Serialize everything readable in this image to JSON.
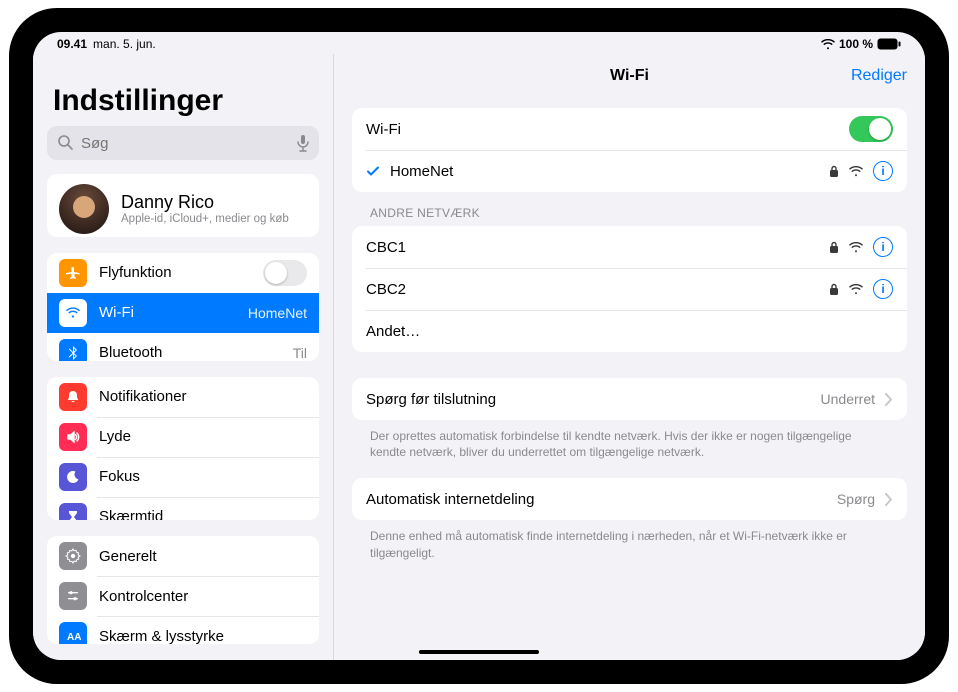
{
  "status": {
    "time": "09.41",
    "date": "man. 5. jun.",
    "battery": "100 %"
  },
  "sidebar": {
    "title": "Indstillinger",
    "search_placeholder": "Søg",
    "account": {
      "name": "Danny Rico",
      "subtitle": "Apple-id, iCloud+, medier og køb"
    },
    "group1": {
      "airplane": "Flyfunktion",
      "wifi": "Wi-Fi",
      "wifi_value": "HomeNet",
      "bt": "Bluetooth",
      "bt_value": "Til"
    },
    "group2": {
      "notifications": "Notifikationer",
      "sounds": "Lyde",
      "focus": "Fokus",
      "screentime": "Skærmtid"
    },
    "group3": {
      "general": "Generelt",
      "control": "Kontrolcenter",
      "display": "Skærm & lysstyrke"
    }
  },
  "detail": {
    "title": "Wi-Fi",
    "edit": "Rediger",
    "wifi_label": "Wi-Fi",
    "connected": "HomeNet",
    "other_header": "ANDRE NETVÆRK",
    "networks": [
      {
        "name": "CBC1"
      },
      {
        "name": "CBC2"
      }
    ],
    "other_item": "Andet…",
    "ask": {
      "label": "Spørg før tilslutning",
      "value": "Underret",
      "note": "Der oprettes automatisk forbindelse til kendte netværk. Hvis der ikke er nogen tilgængelige kendte netværk, bliver du underrettet om tilgængelige netværk."
    },
    "hotspot": {
      "label": "Automatisk internetdeling",
      "value": "Spørg",
      "note": "Denne enhed må automatisk finde internetdeling i nærheden, når et Wi-Fi-netværk ikke er tilgængeligt."
    }
  },
  "colors": {
    "airplane": "#ff9500",
    "wifi": "#007aff",
    "bt": "#007aff",
    "notif": "#ff3b30",
    "sounds": "#ff2d55",
    "focus": "#5856d6",
    "screentime": "#5856d6",
    "general": "#8e8e93",
    "control": "#8e8e93",
    "display": "#007aff"
  }
}
